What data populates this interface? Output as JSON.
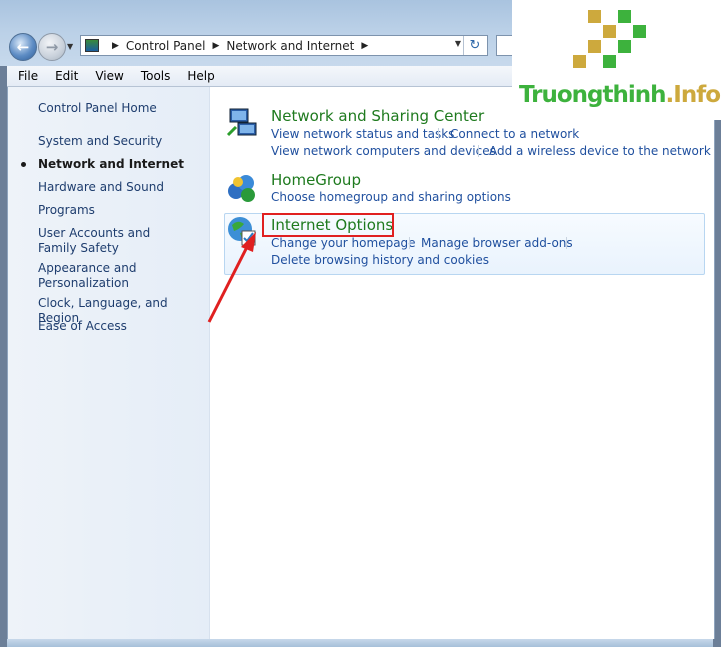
{
  "address_bar": {
    "crumbs": [
      "Control Panel",
      "Network and Internet"
    ]
  },
  "menu": [
    "File",
    "Edit",
    "View",
    "Tools",
    "Help"
  ],
  "sidebar": {
    "home": "Control Panel Home",
    "items": [
      {
        "label": "System and Security",
        "active": false
      },
      {
        "label": "Network and Internet",
        "active": true
      },
      {
        "label": "Hardware and Sound",
        "active": false
      },
      {
        "label": "Programs",
        "active": false
      },
      {
        "label": "User Accounts and Family Safety",
        "active": false
      },
      {
        "label": "Appearance and Personalization",
        "active": false
      },
      {
        "label": "Clock, Language, and Region",
        "active": false
      },
      {
        "label": "Ease of Access",
        "active": false
      }
    ]
  },
  "categories": [
    {
      "title": "Network and Sharing Center",
      "icon": "network-sharing-icon",
      "links": [
        "View network status and tasks",
        "Connect to a network",
        "View network computers and devices",
        "Add a wireless device to the network"
      ]
    },
    {
      "title": "HomeGroup",
      "icon": "homegroup-icon",
      "links": [
        "Choose homegroup and sharing options"
      ]
    },
    {
      "title": "Internet Options",
      "icon": "internet-options-icon",
      "links": [
        "Change your homepage",
        "Manage browser add-ons",
        "Delete browsing history and cookies"
      ]
    }
  ],
  "watermark": {
    "brand_a": "Truongthinh",
    "brand_b": ".Info"
  },
  "colors": {
    "link": "#1f4f9e",
    "title_green": "#1e7a1e",
    "annotation_red": "#e02020",
    "logo_green": "#3db23d",
    "logo_gold": "#cda93d"
  }
}
